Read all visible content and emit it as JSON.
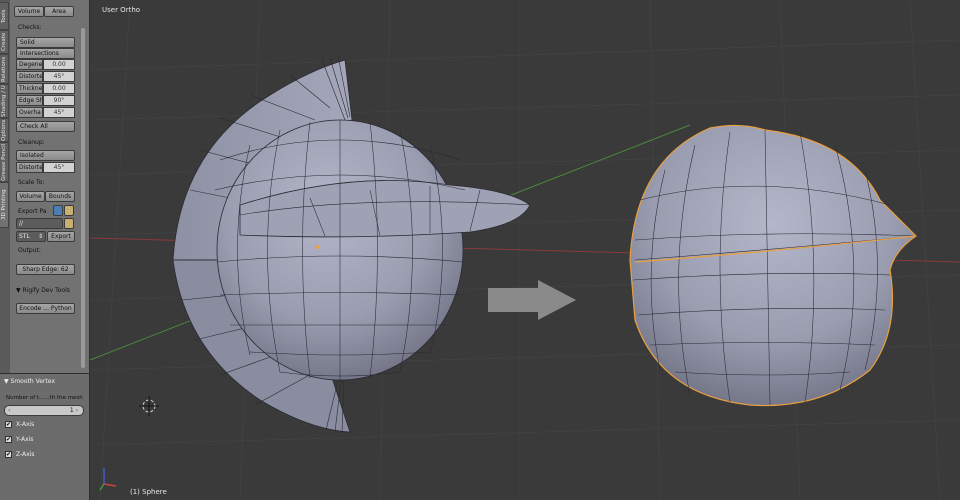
{
  "tool_tabs": [
    "Tools",
    "Create",
    "Relations",
    "Shading / UVs",
    "Options",
    "Grease Pencil",
    "3D Printing"
  ],
  "panel": {
    "stats": {
      "volume_label": "Volume",
      "area_label": "Area"
    },
    "checks": {
      "header": "Checks:",
      "solid_label": "Solid",
      "intersections_label": "Intersections",
      "rows": [
        {
          "label": "Degene",
          "value": "0.00"
        },
        {
          "label": "Distorte",
          "value": "45°"
        },
        {
          "label": "Thickne",
          "value": "0.00"
        },
        {
          "label": "Edge Sh",
          "value": "90°"
        },
        {
          "label": "Overha",
          "value": "45°"
        }
      ],
      "check_all_label": "Check All"
    },
    "cleanup": {
      "header": "Cleanup:",
      "isolated_label": "Isolated",
      "distorted": {
        "label": "Distorte",
        "value": "45°"
      }
    },
    "scale_to": {
      "header": "Scale To:",
      "volume_label": "Volume",
      "bounds_label": "Bounds"
    },
    "export": {
      "path_label": "Export Pa",
      "path_value": "//",
      "format_value": "STL",
      "export_label": "Export"
    },
    "output": {
      "header": "Output:",
      "result_label": "Sharp Edge: 62"
    },
    "rigify": {
      "header": "Rigify Dev Tools",
      "encode_label": "Encode ... Python"
    }
  },
  "redo_panel": {
    "title": "Smooth Vertex",
    "field_label": "Number of t......th the mesh",
    "field_value": "1",
    "checkboxes": [
      {
        "label": "X-Axis",
        "checked": true
      },
      {
        "label": "Y-Axis",
        "checked": true
      },
      {
        "label": "Z-Axis",
        "checked": true
      }
    ]
  },
  "viewport": {
    "view_name": "User Ortho",
    "object_name": "(1) Sphere"
  },
  "colors": {
    "mesh_light": "#b4b6ca",
    "mesh_mid": "#9a9cb0",
    "mesh_dark": "#6e7082",
    "selection": "#e8a040",
    "grid_x": "#8a3a3a",
    "grid_y": "#4a8a3a"
  }
}
